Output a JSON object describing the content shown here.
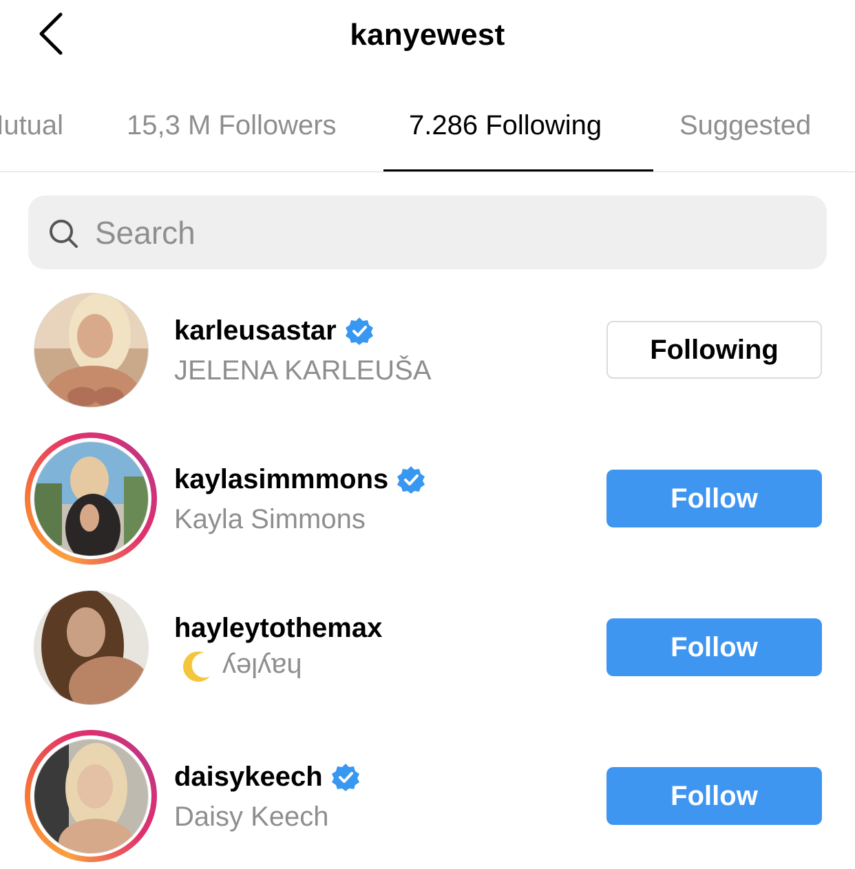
{
  "header": {
    "title": "kanyewest"
  },
  "tabs": [
    {
      "label": "Mutual"
    },
    {
      "label": "15,3 M Followers"
    },
    {
      "label": "7.286 Following"
    },
    {
      "label": "Suggested"
    }
  ],
  "search": {
    "placeholder": "Search"
  },
  "users": [
    {
      "username": "karleusastar",
      "fullname": "JELENA KARLEUŠA",
      "verified": true,
      "has_story": false,
      "button": "Following"
    },
    {
      "username": "kaylasimmmons",
      "fullname": "Kayla Simmons",
      "verified": true,
      "has_story": true,
      "button": "Follow"
    },
    {
      "username": "hayleytothemax",
      "fullname": "hayley",
      "verified": false,
      "has_story": false,
      "button": "Follow"
    },
    {
      "username": "daisykeech",
      "fullname": "Daisy Keech",
      "verified": true,
      "has_story": true,
      "button": "Follow"
    }
  ],
  "colors": {
    "follow_button": "#3f96f0",
    "verified_badge": "#3897f0",
    "muted_text": "#8e8e8e"
  }
}
